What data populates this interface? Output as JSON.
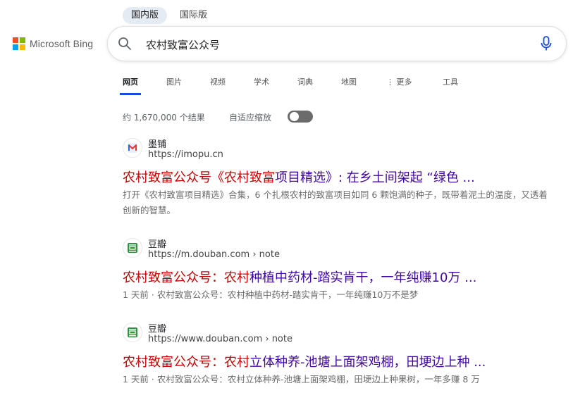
{
  "region": {
    "domestic": "国内版",
    "international": "国际版"
  },
  "logo": {
    "text": "Microsoft Bing",
    "colors": [
      "#f25022",
      "#7fba00",
      "#00a4ef",
      "#ffb900"
    ]
  },
  "search": {
    "value": "农村致富公众号",
    "icon": "search-icon",
    "mic_icon": "microphone-icon"
  },
  "tabs": [
    {
      "label": "网页"
    },
    {
      "label": "图片"
    },
    {
      "label": "视频"
    },
    {
      "label": "学术"
    },
    {
      "label": "词典"
    },
    {
      "label": "地图"
    },
    {
      "label": "⋮ 更多"
    },
    {
      "label": "工具"
    }
  ],
  "stats": {
    "count": "约 1,670,000 个结果",
    "adaptive_label": "自适应缩放"
  },
  "results": [
    {
      "site": "墨铺",
      "url": "https://imopu.cn",
      "title_hl": "农村致富公众号《农村致富",
      "title_rest": "项目精选》: 在乡土间架起 “绿色 ...",
      "snippet": "打开《农村致富项目精选》合集，6 个扎根农村的致富项目如同 6 颗饱满的种子，既带着泥土的温度，又透着创新的智慧。"
    },
    {
      "site": "豆瓣",
      "url": "https://m.douban.com › note",
      "title_hl": "农村致富公众号：农村",
      "title_rest": "种植中药材-踏实肯干，一年纯赚10万 ...",
      "time": "1 天前 ·",
      "snippet": "农村致富公众号：农村种植中药材-踏实肯干，一年纯赚10万不是梦"
    },
    {
      "site": "豆瓣",
      "url": "https://www.douban.com › note",
      "title_hl": "农村致富公众号：农村",
      "title_rest": "立体种养-池塘上面架鸡棚，田埂边上种 ...",
      "time": "1 天前 ·",
      "snippet": "农村致富公众号：农村立体种养-池塘上面架鸡棚，田埂边上种果树，一年多赚 8 万"
    }
  ]
}
